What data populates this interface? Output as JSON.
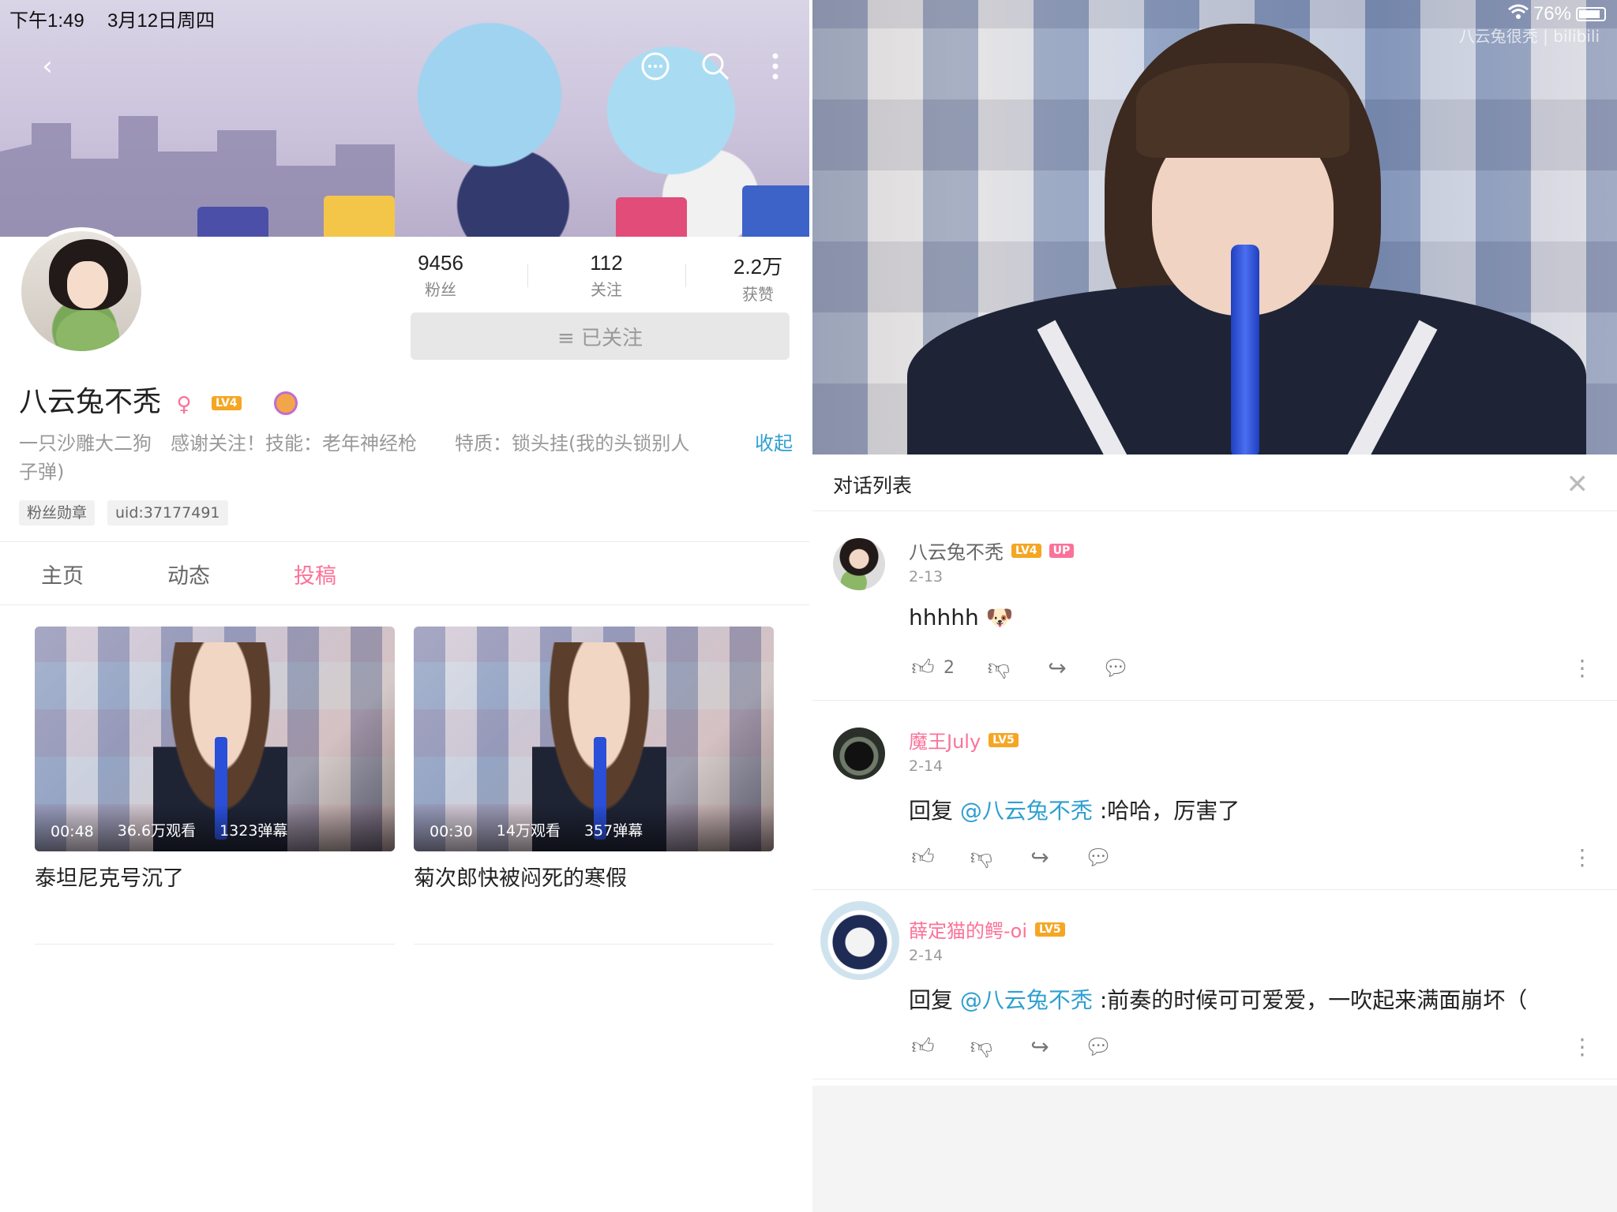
{
  "status_bar": {
    "time": "下午1:49",
    "date": "3月12日周四",
    "battery": "76%"
  },
  "profile": {
    "name": "八云兔不秃",
    "level": "LV4",
    "stats": [
      {
        "value": "9456",
        "label": "粉丝"
      },
      {
        "value": "112",
        "label": "关注"
      },
      {
        "value": "2.2万",
        "label": "获赞"
      }
    ],
    "follow_button": "≡ 已关注",
    "bio": "一只沙雕大二狗　感谢关注！技能：老年神经枪　　特质：锁头挂(我的头锁别人子弹)",
    "bio_collapse": "收起",
    "tags": [
      "粉丝勋章",
      "uid:37177491"
    ]
  },
  "tabs": [
    {
      "label": "主页",
      "active": false
    },
    {
      "label": "动态",
      "active": false
    },
    {
      "label": "投稿",
      "active": true
    }
  ],
  "videos": [
    {
      "duration": "00:48",
      "views": "36.6万观看",
      "danmaku": "1323弹幕",
      "title": "泰坦尼克号沉了"
    },
    {
      "duration": "00:30",
      "views": "14万观看",
      "danmaku": "357弹幕",
      "title": "菊次郎快被闷死的寒假"
    }
  ],
  "player": {
    "watermark": "八云兔很秃 | bilibili"
  },
  "dialog": {
    "title": "对话列表",
    "comments": [
      {
        "name": "八云兔不秃",
        "level": "LV4",
        "up": "UP",
        "date": "2-13",
        "text": "hhhhh",
        "emoji": "🐶",
        "likes": "2",
        "name_color": "#666666"
      },
      {
        "name": "魔王July",
        "level": "LV5",
        "date": "2-14",
        "reply": "回复 ",
        "mention": "@八云兔不秃",
        "text": " :哈哈，厉害了",
        "name_color": "#fb7299"
      },
      {
        "name": "薛定猫的鳄-oi",
        "level": "LV5",
        "date": "2-14",
        "reply": "回复 ",
        "mention": "@八云兔不秃",
        "text": " :前奏的时候可可爱爱，一吹起来满面崩坏（",
        "name_color": "#fb7299"
      }
    ]
  },
  "colors": {
    "accent": "#fb7299",
    "link": "#2f9fd0"
  }
}
